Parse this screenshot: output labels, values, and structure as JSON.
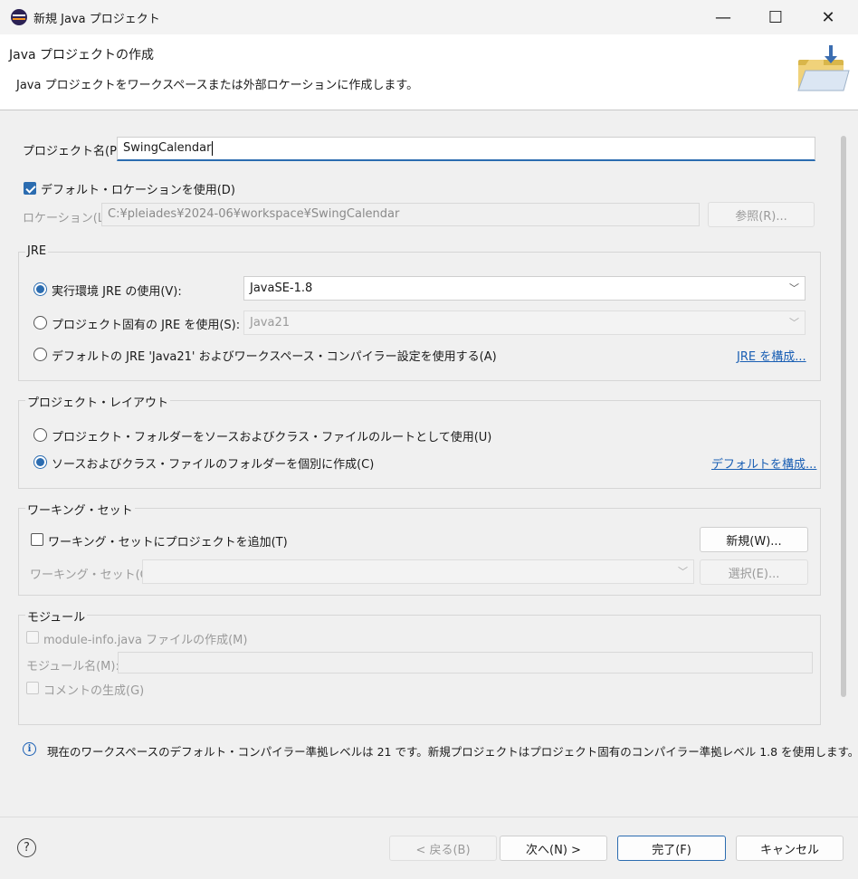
{
  "window": {
    "title": "新規 Java プロジェクト",
    "minimize": "—",
    "maximize": "☐",
    "close": "✕"
  },
  "banner": {
    "title": "Java プロジェクトの作成",
    "description": "Java プロジェクトをワークスペースまたは外部ロケーションに作成します。"
  },
  "project": {
    "name_label": "プロジェクト名(P):",
    "name_value": "SwingCalendar"
  },
  "location": {
    "use_default_label": "デフォルト・ロケーションを使用(D)",
    "use_default_checked": true,
    "label": "ロケーション(L):",
    "value": "C:¥pleiades¥2024-06¥workspace¥SwingCalendar",
    "browse_button": "参照(R)..."
  },
  "jre": {
    "group_title": "JRE",
    "option_env_label": "実行環境 JRE の使用(V):",
    "option_env_value": "JavaSE-1.8",
    "option_project_label": "プロジェクト固有の JRE を使用(S):",
    "option_project_value": "Java21",
    "option_default_label": "デフォルトの JRE 'Java21' およびワークスペース・コンパイラー設定を使用する(A)",
    "configure_link": "JRE を構成...",
    "selected": "env"
  },
  "layout": {
    "group_title": "プロジェクト・レイアウト",
    "option_root_label": "プロジェクト・フォルダーをソースおよびクラス・ファイルのルートとして使用(U)",
    "option_separate_label": "ソースおよびクラス・ファイルのフォルダーを個別に作成(C)",
    "configure_link": "デフォルトを構成...",
    "selected": "separate"
  },
  "working_set": {
    "group_title": "ワーキング・セット",
    "add_label": "ワーキング・セットにプロジェクトを追加(T)",
    "new_button": "新規(W)...",
    "sets_label": "ワーキング・セット(O):",
    "select_button": "選択(E)..."
  },
  "module": {
    "group_title": "モジュール",
    "create_label": "module-info.java ファイルの作成(M)",
    "name_label": "モジュール名(M):",
    "comment_label": "コメントの生成(G)"
  },
  "info_message": "現在のワークスペースのデフォルト・コンパイラー準拠レベルは 21 です。新規プロジェクトはプロジェクト固有のコンパイラー準拠レベル 1.8 を使用します。",
  "footer": {
    "help": "?",
    "back_button": "< 戻る(B)",
    "next_button": "次へ(N) >",
    "finish_button": "完了(F)",
    "cancel_button": "キャンセル"
  },
  "colors": {
    "accent": "#2b6cb0",
    "link": "#1a5fb4"
  }
}
